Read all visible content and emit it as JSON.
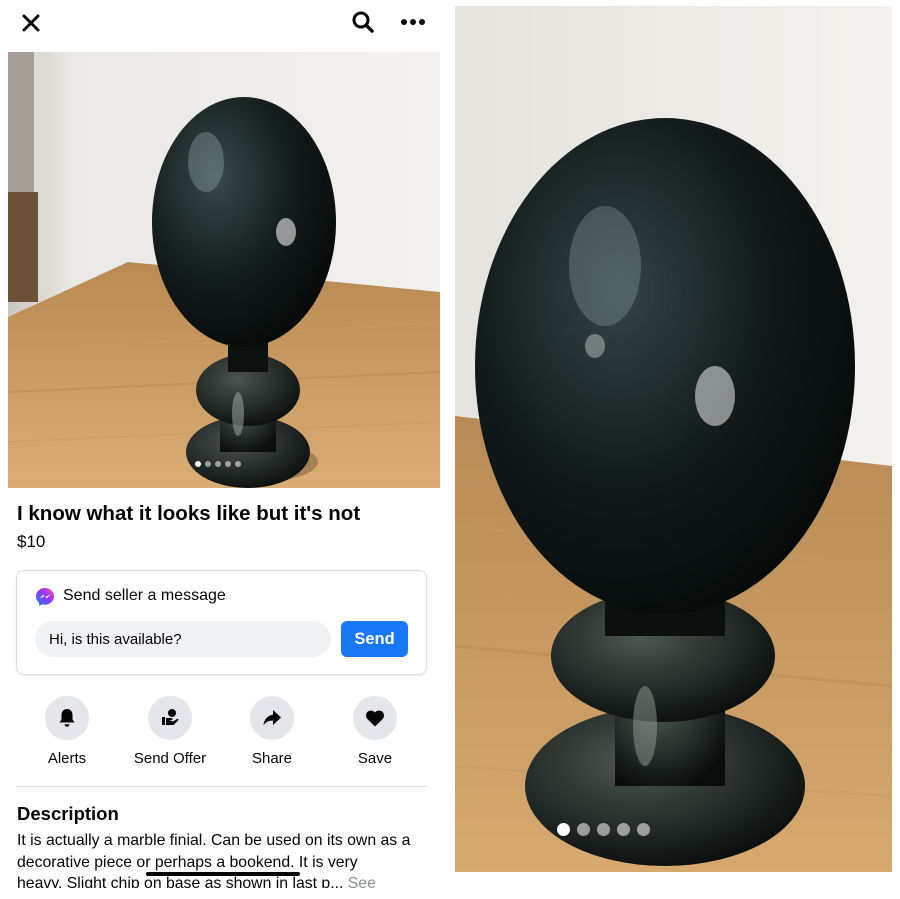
{
  "toolbar": {
    "close_icon": "close-icon",
    "search_icon": "search-icon",
    "more_icon": "more-horizontal-icon"
  },
  "listing": {
    "photo_count": 5,
    "active_photo_index": 1,
    "title": "I know what it looks like but it's not",
    "price": "$10"
  },
  "message": {
    "heading": "Send seller a message",
    "input_value": "Hi, is this available?",
    "send_label": "Send",
    "icon": "messenger-icon",
    "accent_color": "#1877f2"
  },
  "actions": [
    {
      "label": "Alerts",
      "icon": "bell-icon"
    },
    {
      "label": "Send Offer",
      "icon": "send-offer-icon"
    },
    {
      "label": "Share",
      "icon": "share-arrow-icon"
    },
    {
      "label": "Save",
      "icon": "heart-icon"
    }
  ],
  "description": {
    "heading": "Description",
    "line1": "It is actually a marble finial. Can be used on its own as a",
    "line2": "decorative piece or perhaps a bookend. It is very",
    "line3": "heavy. Slight chip on base as shown in last p...",
    "see_more": "See"
  }
}
